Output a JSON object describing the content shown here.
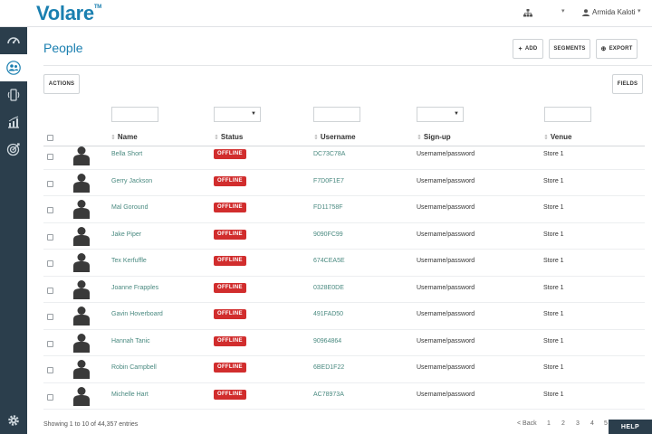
{
  "header": {
    "logo": "Volare",
    "logo_tm": "TM",
    "user_name": "Armida Kaloti",
    "caret": "▾"
  },
  "colors": {
    "brand": "#1a7fb0",
    "sidebar": "#2b3e4c",
    "offline": "#d12d2d",
    "link": "#4a8a80"
  },
  "sidebar": {
    "items": [
      {
        "icon": "speedometer-icon",
        "active": false
      },
      {
        "icon": "people-icon",
        "active": true
      },
      {
        "icon": "mobile-signal-icon",
        "active": false
      },
      {
        "icon": "bar-chart-icon",
        "active": false
      },
      {
        "icon": "target-icon",
        "active": false
      }
    ],
    "bottom_icon": "gear-icon"
  },
  "page": {
    "title": "People",
    "buttons": {
      "add": "ADD",
      "add_glyph": "+",
      "segments": "SEGMENTS",
      "export": "EXPORT",
      "export_glyph": "⊕",
      "actions": "ACTIONS",
      "fields": "FIELDS"
    }
  },
  "table": {
    "sort_glyph": "⇕",
    "columns": {
      "name": "Name",
      "status": "Status",
      "username": "Username",
      "signup": "Sign-up",
      "venue": "Venue"
    },
    "rows": [
      {
        "name": "Bella Short",
        "status": "OFFLINE",
        "username": "DC73C78A",
        "signup": "Username/password",
        "venue": "Store 1"
      },
      {
        "name": "Gerry Jackson",
        "status": "OFFLINE",
        "username": "F7D0F1E7",
        "signup": "Username/password",
        "venue": "Store 1"
      },
      {
        "name": "Mal Goround",
        "status": "OFFLINE",
        "username": "FD11758F",
        "signup": "Username/password",
        "venue": "Store 1"
      },
      {
        "name": "Jake Piper",
        "status": "OFFLINE",
        "username": "9090FC99",
        "signup": "Username/password",
        "venue": "Store 1"
      },
      {
        "name": "Tex Kerfuffle",
        "status": "OFFLINE",
        "username": "674CEA5E",
        "signup": "Username/password",
        "venue": "Store 1"
      },
      {
        "name": "Joanne Frapples",
        "status": "OFFLINE",
        "username": "0328E0DE",
        "signup": "Username/password",
        "venue": "Store 1"
      },
      {
        "name": "Gavin Hoverboard",
        "status": "OFFLINE",
        "username": "491FAD50",
        "signup": "Username/password",
        "venue": "Store 1"
      },
      {
        "name": "Hannah Tanic",
        "status": "OFFLINE",
        "username": "90964864",
        "signup": "Username/password",
        "venue": "Store 1"
      },
      {
        "name": "Robin Campbell",
        "status": "OFFLINE",
        "username": "6BED1F22",
        "signup": "Username/password",
        "venue": "Store 1"
      },
      {
        "name": "Michelle Hart",
        "status": "OFFLINE",
        "username": "AC78973A",
        "signup": "Username/password",
        "venue": "Store 1"
      }
    ]
  },
  "footer": {
    "entries": "Showing 1 to 10 of 44,357 entries",
    "pager": {
      "back": "< Back",
      "pages": [
        "1",
        "2",
        "3",
        "4",
        "5"
      ]
    },
    "help": "HELP"
  }
}
